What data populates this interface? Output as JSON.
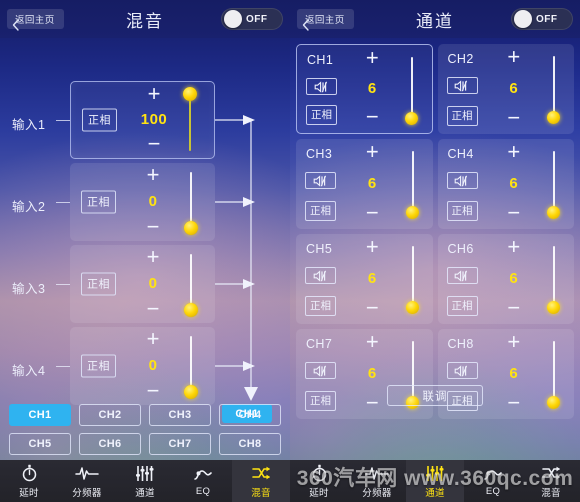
{
  "left_panel": {
    "topbar": {
      "back_label": "返回主页",
      "back_icon": "chevron-left-icon",
      "title": "混音",
      "toggle_label": "OFF",
      "toggle_state": "off"
    },
    "inputs": [
      {
        "label": "输入1",
        "phase_label": "正相",
        "gain": "100",
        "plus": "+",
        "minus": "−",
        "slider_pos": "top",
        "active": true
      },
      {
        "label": "输入2",
        "phase_label": "正相",
        "gain": "0",
        "plus": "+",
        "minus": "−",
        "slider_pos": "bottom",
        "active": false
      },
      {
        "label": "输入3",
        "phase_label": "正相",
        "gain": "0",
        "plus": "+",
        "minus": "−",
        "slider_pos": "bottom",
        "active": false
      },
      {
        "label": "输入4",
        "phase_label": "正相",
        "gain": "0",
        "plus": "+",
        "minus": "−",
        "slider_pos": "bottom",
        "active": false
      }
    ],
    "routing": {
      "bus_output_label": "CH1",
      "arrow_count": 4
    },
    "channel_buttons": [
      {
        "label": "CH1",
        "selected": true
      },
      {
        "label": "CH2",
        "selected": false
      },
      {
        "label": "CH3",
        "selected": false
      },
      {
        "label": "CH4",
        "selected": false
      },
      {
        "label": "CH5",
        "selected": false
      },
      {
        "label": "CH6",
        "selected": false
      },
      {
        "label": "CH7",
        "selected": false
      },
      {
        "label": "CH8",
        "selected": false
      }
    ],
    "nav": [
      {
        "label": "延时",
        "icon": "stopwatch-icon",
        "active": false
      },
      {
        "label": "分频器",
        "icon": "waveform-icon",
        "active": false
      },
      {
        "label": "通道",
        "icon": "sliders-icon",
        "active": false
      },
      {
        "label": "EQ",
        "icon": "eq-curve-icon",
        "active": false
      },
      {
        "label": "混音",
        "icon": "shuffle-icon",
        "active": true
      }
    ]
  },
  "right_panel": {
    "topbar": {
      "back_label": "返回主页",
      "back_icon": "chevron-left-icon",
      "title": "通道",
      "toggle_label": "OFF",
      "toggle_state": "off"
    },
    "channels": [
      {
        "name": "CH1",
        "mute_icon": "speaker-mute-icon",
        "phase_label": "正相",
        "gain": "6",
        "plus": "+",
        "minus": "−",
        "active": true
      },
      {
        "name": "CH2",
        "mute_icon": "speaker-mute-icon",
        "phase_label": "正相",
        "gain": "6",
        "plus": "+",
        "minus": "−",
        "active": false
      },
      {
        "name": "CH3",
        "mute_icon": "speaker-mute-icon",
        "phase_label": "正相",
        "gain": "6",
        "plus": "+",
        "minus": "−",
        "active": false
      },
      {
        "name": "CH4",
        "mute_icon": "speaker-mute-icon",
        "phase_label": "正相",
        "gain": "6",
        "plus": "+",
        "minus": "−",
        "active": false
      },
      {
        "name": "CH5",
        "mute_icon": "speaker-mute-icon",
        "phase_label": "正相",
        "gain": "6",
        "plus": "+",
        "minus": "−",
        "active": false
      },
      {
        "name": "CH6",
        "mute_icon": "speaker-mute-icon",
        "phase_label": "正相",
        "gain": "6",
        "plus": "+",
        "minus": "−",
        "active": false
      },
      {
        "name": "CH7",
        "mute_icon": "speaker-mute-icon",
        "phase_label": "正相",
        "gain": "6",
        "plus": "+",
        "minus": "−",
        "active": false
      },
      {
        "name": "CH8",
        "mute_icon": "speaker-mute-icon",
        "phase_label": "正相",
        "gain": "6",
        "plus": "+",
        "minus": "−",
        "active": false
      }
    ],
    "link_button_label": "联调",
    "nav": [
      {
        "label": "延时",
        "icon": "stopwatch-icon",
        "active": false
      },
      {
        "label": "分频器",
        "icon": "waveform-icon",
        "active": false
      },
      {
        "label": "通道",
        "icon": "sliders-icon",
        "active": true
      },
      {
        "label": "EQ",
        "icon": "eq-curve-icon",
        "active": false
      },
      {
        "label": "混音",
        "icon": "shuffle-icon",
        "active": false
      }
    ]
  },
  "watermark": "360汽车网 www.360qc.com",
  "colors": {
    "accent_yellow": "#ffe312",
    "accent_blue": "#2fb3f0",
    "knob_yellow": "#ffd708",
    "header_blue": "#19216e",
    "nav_bg": "#2a2a33"
  }
}
